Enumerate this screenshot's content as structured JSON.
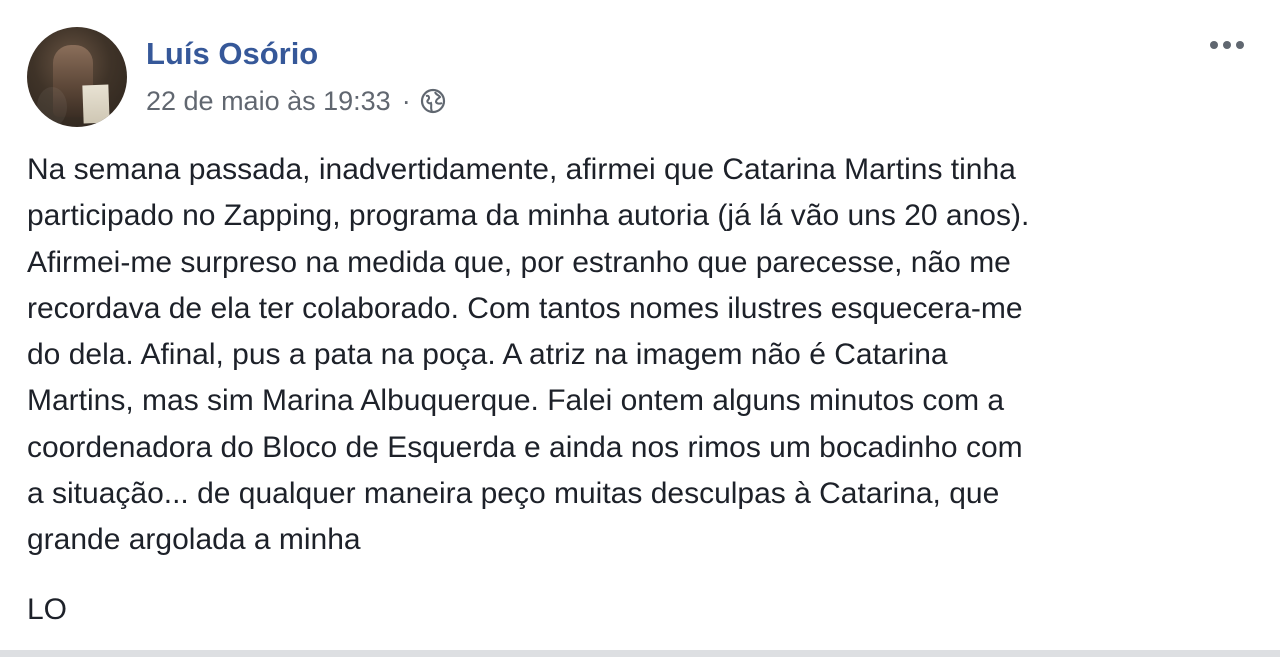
{
  "post": {
    "author": "Luís Osório",
    "timestamp": "22 de maio às 19:33",
    "separator": "·",
    "privacy_icon": "globe-icon",
    "more_icon": "more-options-icon",
    "body": "Na semana passada, inadvertidamente, afirmei que Catarina Martins tinha\nparticipado no Zapping, programa da minha autoria (já lá vão uns 20 anos).\nAfirmei-me surpreso na medida que, por estranho que parecesse, não me\nrecordava de ela ter colaborado. Com tantos nomes ilustres esquecera-me\ndo dela. Afinal, pus a pata na poça. A atriz na imagem não é Catarina\nMartins, mas sim Marina Albuquerque. Falei ontem alguns minutos com a\ncoordenadora do Bloco de Esquerda e ainda nos rimos um bocadinho com\na situação... de qualquer maneira peço muitas desculpas à Catarina, que\ngrande argolada a minha",
    "signature": "LO"
  },
  "colors": {
    "author_link": "#365899",
    "meta_text": "#616770",
    "body_text": "#1d2129",
    "icon": "#606770"
  }
}
